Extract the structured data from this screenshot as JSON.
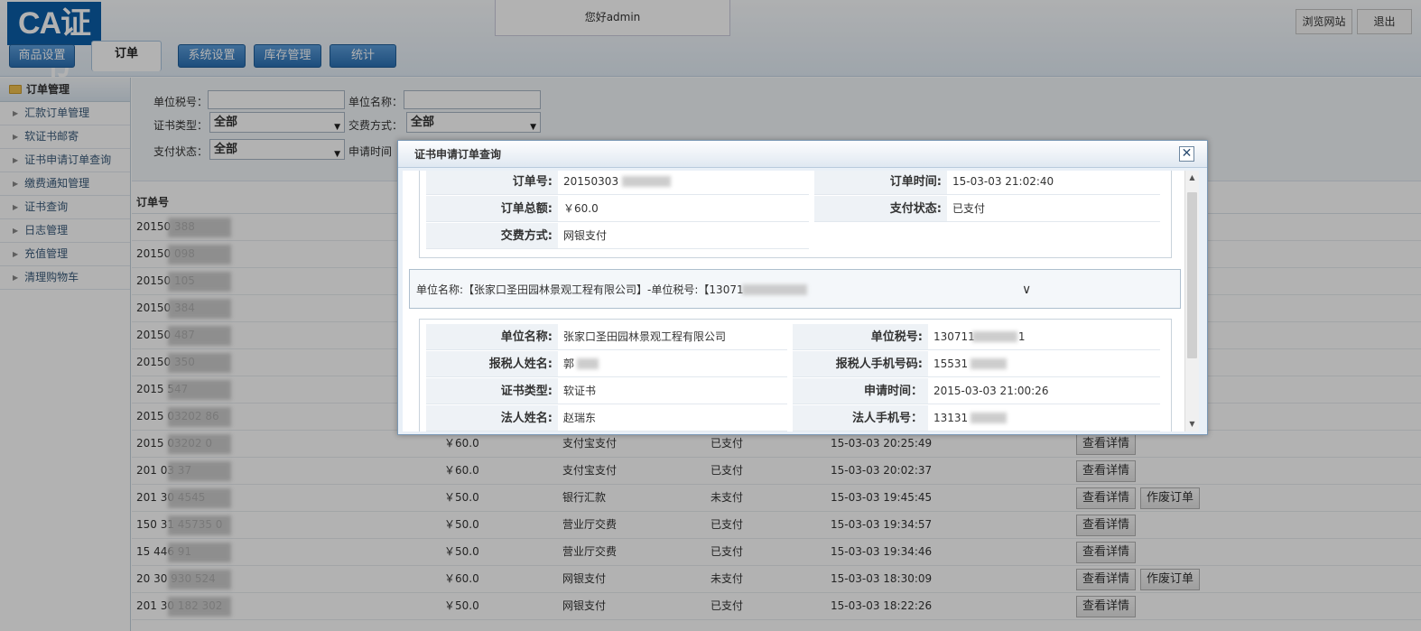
{
  "header": {
    "logo": "CA证书",
    "greeting": "您好admin",
    "browse_label": "浏览网站",
    "logout_label": "退出",
    "tabs": [
      {
        "label": "商品设置"
      },
      {
        "label": "订单",
        "active": true
      },
      {
        "label": "系统设置"
      },
      {
        "label": "库存管理"
      },
      {
        "label": "统计"
      }
    ]
  },
  "sidebar": {
    "title": "订单管理",
    "items": [
      {
        "label": "汇款订单管理"
      },
      {
        "label": "软证书邮寄"
      },
      {
        "label": "证书申请订单查询"
      },
      {
        "label": "缴费通知管理"
      },
      {
        "label": "证书查询"
      },
      {
        "label": "日志管理"
      },
      {
        "label": "充值管理"
      },
      {
        "label": "清理购物车"
      }
    ]
  },
  "filter": {
    "tax_no_label": "单位税号：",
    "unit_name_label": "单位名称：",
    "cert_type_label": "证书类型：",
    "cert_type_value": "全部",
    "pay_method_label": "交费方式：",
    "pay_method_value": "全部",
    "pay_status_label": "支付状态：",
    "pay_status_value": "全部",
    "apply_time_label": "申请时间"
  },
  "table": {
    "order_no_header": "订单号",
    "detail_label": "查看详情",
    "void_label": "作废订单",
    "rows": [
      {
        "order": "20150  388"
      },
      {
        "order": "20150  098"
      },
      {
        "order": "20150  105"
      },
      {
        "order": "20150  384"
      },
      {
        "order": "20150  487"
      },
      {
        "order": "20150  350"
      },
      {
        "order": "2015   547"
      },
      {
        "order": "2015  03202  86"
      },
      {
        "order": "2015  03202   0",
        "amount": "￥60.0",
        "method": "支付宝支付",
        "status": "已支付",
        "time": "15-03-03 20:25:49",
        "void": false
      },
      {
        "order": "201  03  37",
        "amount": "￥60.0",
        "method": "支付宝支付",
        "status": "已支付",
        "time": "15-03-03 20:02:37",
        "void": false
      },
      {
        "order": "201  30  4545",
        "amount": "￥50.0",
        "method": "银行汇款",
        "status": "未支付",
        "time": "15-03-03 19:45:45",
        "void": true
      },
      {
        "order": "150  31  45735  0",
        "amount": "￥50.0",
        "method": "营业厅交费",
        "status": "已支付",
        "time": "15-03-03 19:34:57",
        "void": false
      },
      {
        "order": "15  446  91",
        "amount": "￥50.0",
        "method": "营业厅交费",
        "status": "已支付",
        "time": "15-03-03 19:34:46",
        "void": false
      },
      {
        "order": "20  30  930  524",
        "amount": "￥60.0",
        "method": "网银支付",
        "status": "未支付",
        "time": "15-03-03 18:30:09",
        "void": true
      },
      {
        "order": "201  30  182  302",
        "amount": "￥50.0",
        "method": "网银支付",
        "status": "已支付",
        "time": "15-03-03 18:22:26",
        "void": false
      }
    ]
  },
  "modal": {
    "title": "证书申请订单查询",
    "close": "✕",
    "order": {
      "order_no_label": "订单号:",
      "order_no_value": "20150303",
      "order_time_label": "订单时间:",
      "order_time_value": "15-03-03 21:02:40",
      "total_label": "订单总额:",
      "total_value": "￥60.0",
      "pay_status_label": "支付状态:",
      "pay_status_value": "已支付",
      "pay_method_label": "交费方式:",
      "pay_method_value": "网银支付"
    },
    "company_bar": "单位名称:【张家口圣田园林景观工程有限公司】-单位税号:【13071",
    "company": {
      "unit_name_label": "单位名称:",
      "unit_name_value": "张家口圣田园林景观工程有限公司",
      "tax_no_label": "单位税号:",
      "tax_no_value": "130711",
      "tax_no_suffix": "1",
      "reporter_label": "报税人姓名:",
      "reporter_value": "郭",
      "reporter_phone_label": "报税人手机号码:",
      "reporter_phone_value": "15531",
      "cert_type_label": "证书类型:",
      "cert_type_value": "软证书",
      "apply_time_label": "申请时间：",
      "apply_time_value": "2015-03-03 21:00:26",
      "legal_name_label": "法人姓名:",
      "legal_name_value": "赵瑞东",
      "legal_phone_label": "法人手机号：",
      "legal_phone_value": "13131"
    }
  }
}
